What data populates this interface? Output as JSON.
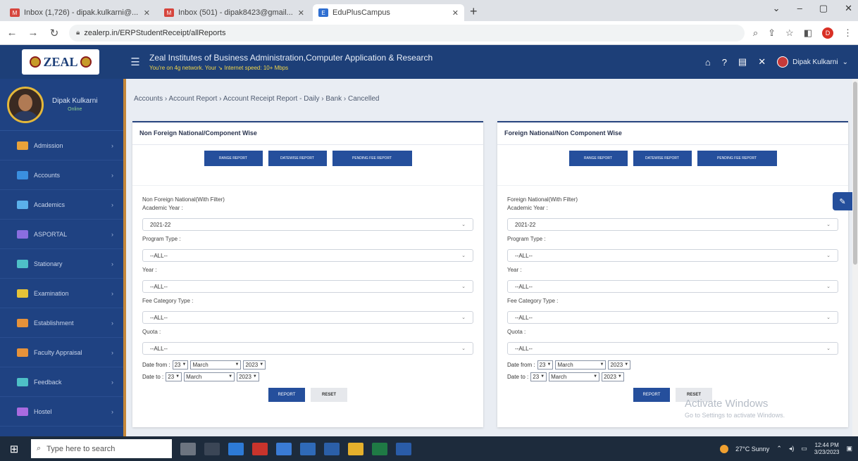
{
  "browser": {
    "tabs": [
      {
        "label": "Inbox (1,726) - dipak.kulkarni@...",
        "active": false
      },
      {
        "label": "Inbox (501) - dipak8423@gmail...",
        "active": false
      },
      {
        "label": "EduPlusCampus",
        "active": true
      }
    ],
    "url": "zealerp.in/ERPStudentReceipt/allReports"
  },
  "header": {
    "logo_text": "ZEAL",
    "institute_name": "Zeal Institutes of Business Administration,Computer Application & Research",
    "network_status": "You're on 4g network. Your ↘ Internet speed: 10+ Mbps",
    "user_name": "Dipak Kulkarni"
  },
  "sidebar": {
    "profile_name": "Dipak Kulkarni",
    "profile_status": "Online",
    "items": [
      {
        "label": "Admission",
        "color": "#e8a23a"
      },
      {
        "label": "Accounts",
        "color": "#3a8fe0"
      },
      {
        "label": "Academics",
        "color": "#5bb0ea"
      },
      {
        "label": "ASPORTAL",
        "color": "#8a6ee0"
      },
      {
        "label": "Stationary",
        "color": "#4ec0c7"
      },
      {
        "label": "Examination",
        "color": "#e6c338"
      },
      {
        "label": "Establishment",
        "color": "#e6923a"
      },
      {
        "label": "Faculty Appraisal",
        "color": "#e6923a"
      },
      {
        "label": "Feedback",
        "color": "#4ec0c7"
      },
      {
        "label": "Hostel",
        "color": "#a96be0"
      }
    ]
  },
  "breadcrumb": "Accounts › Account Report › Account Receipt Report - Daily › Bank › Cancelled",
  "panels": {
    "left": {
      "title": "Non Foreign National/Component Wise",
      "buttons": [
        "RANGE REPORT",
        "DATEWISE REPORT",
        "PENDING FEE REPORT"
      ],
      "filter_title": "Non Foreign National(With Filter)",
      "fields": [
        {
          "label": "Academic Year :",
          "value": "2021-22"
        },
        {
          "label": "Program Type :",
          "value": "--ALL--"
        },
        {
          "label": "Year :",
          "value": "--ALL--"
        },
        {
          "label": "Fee Category Type :",
          "value": "--ALL--"
        },
        {
          "label": "Quota :",
          "value": "--ALL--"
        }
      ],
      "date_from_label": "Date from :",
      "date_to_label": "Date to :",
      "date_from": {
        "day": "23",
        "month": "March",
        "year": "2023"
      },
      "date_to": {
        "day": "23",
        "month": "March",
        "year": "2023"
      },
      "report_label": "REPORT",
      "reset_label": "RESET"
    },
    "right": {
      "title": "Foreign National/Non Component Wise",
      "buttons": [
        "RANGE REPORT",
        "DATEWISE REPORT",
        "PENDING FEE REPORT"
      ],
      "filter_title": "Foreign National(With Filter)",
      "fields": [
        {
          "label": "Academic Year :",
          "value": "2021-22"
        },
        {
          "label": "Program Type :",
          "value": "--ALL--"
        },
        {
          "label": "Year :",
          "value": "--ALL--"
        },
        {
          "label": "Fee Category Type :",
          "value": "--ALL--"
        },
        {
          "label": "Quota :",
          "value": "--ALL--"
        }
      ],
      "date_from_label": "Date from :",
      "date_to_label": "Date to :",
      "date_from": {
        "day": "23",
        "month": "March",
        "year": "2023"
      },
      "date_to": {
        "day": "23",
        "month": "March",
        "year": "2023"
      },
      "report_label": "REPORT",
      "reset_label": "RESET"
    }
  },
  "watermark": {
    "line1": "Activate Windows",
    "line2": "Go to Settings to activate Windows."
  },
  "taskbar": {
    "search_placeholder": "Type here to search",
    "weather": "27°C  Sunny",
    "time": "12:44 PM",
    "date": "3/23/2023"
  }
}
